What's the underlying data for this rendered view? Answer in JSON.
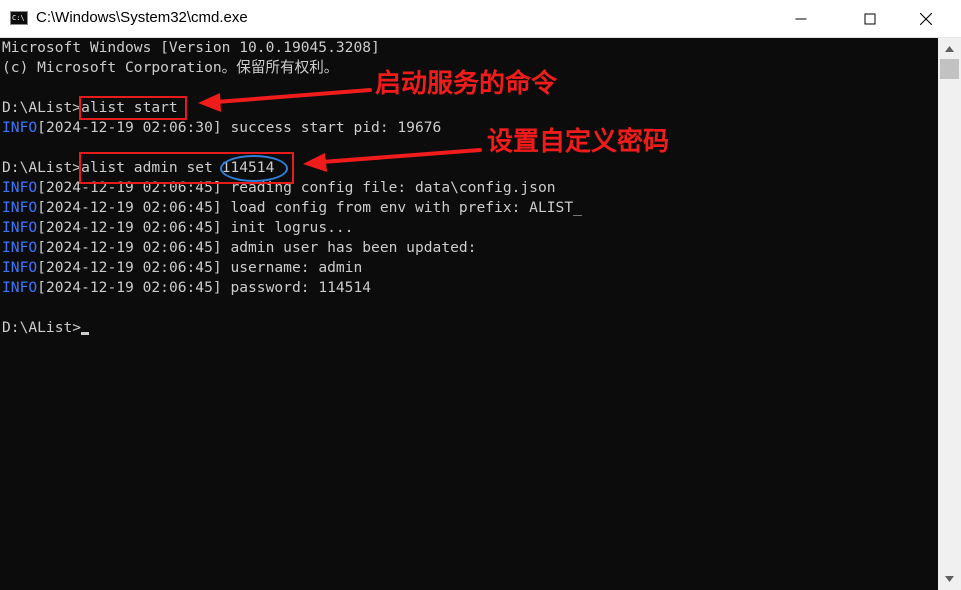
{
  "window": {
    "title": "C:\\Windows\\System32\\cmd.exe",
    "app_icon_text": "C:\\",
    "controls": [
      "minimize",
      "maximize",
      "close"
    ]
  },
  "console": {
    "lines": [
      {
        "text": "Microsoft Windows [Version 10.0.19045.3208]"
      },
      {
        "text": "(c) Microsoft Corporation。保留所有权利。"
      },
      {
        "text": ""
      },
      {
        "text": "D:\\AList>alist start"
      },
      {
        "tag": "INFO",
        "text": "[2024-12-19 02:06:30] success start pid: 19676"
      },
      {
        "text": ""
      },
      {
        "text": "D:\\AList>alist admin set 114514"
      },
      {
        "tag": "INFO",
        "text": "[2024-12-19 02:06:45] reading config file: data\\config.json"
      },
      {
        "tag": "INFO",
        "text": "[2024-12-19 02:06:45] load config from env with prefix: ALIST_"
      },
      {
        "tag": "INFO",
        "text": "[2024-12-19 02:06:45] init logrus..."
      },
      {
        "tag": "INFO",
        "text": "[2024-12-19 02:06:45] admin user has been updated:"
      },
      {
        "tag": "INFO",
        "text": "[2024-12-19 02:06:45] username: admin"
      },
      {
        "tag": "INFO",
        "text": "[2024-12-19 02:06:45] password: 114514"
      },
      {
        "text": ""
      },
      {
        "text": "D:\\AList>"
      }
    ]
  },
  "annotations": {
    "start_command": "启动服务的命令",
    "set_password": "设置自定义密码"
  },
  "colors": {
    "console_bg": "#0c0c0c",
    "console_text": "#cccccc",
    "info_tag": "#3b78ff",
    "annotation": "#f01c1c",
    "highlight_circle": "#2f7ed8"
  }
}
